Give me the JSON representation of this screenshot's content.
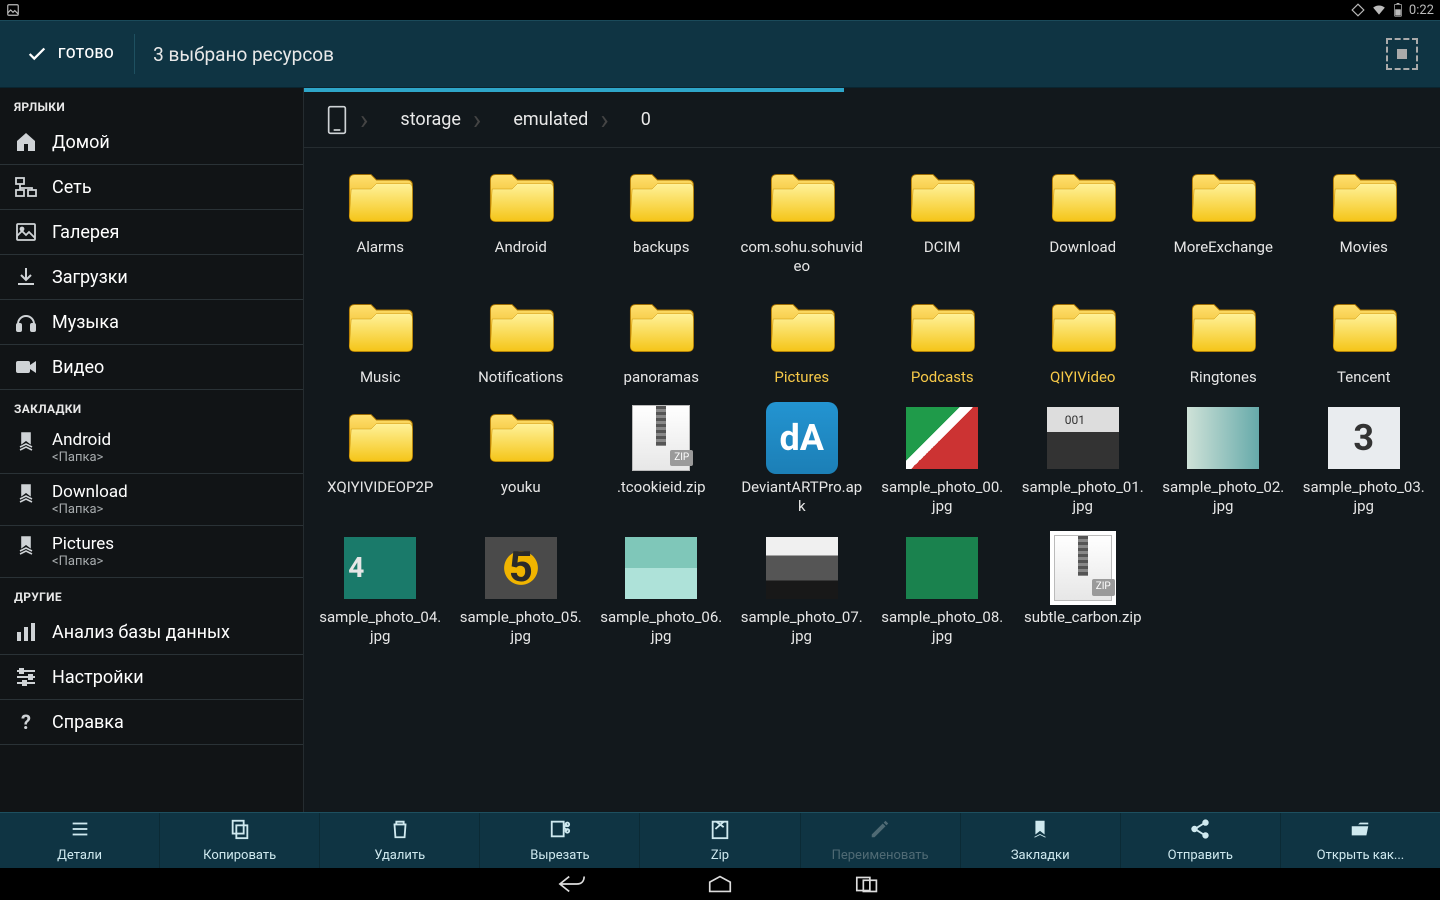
{
  "status_bar": {
    "time": "0:22"
  },
  "action_bar": {
    "done": "ГОТОВО",
    "title": "3 выбрано ресурсов"
  },
  "sidebar": {
    "sections": {
      "shortcuts": {
        "header": "ЯРЛЫКИ",
        "items": [
          {
            "label": "Домой",
            "icon": "home-icon"
          },
          {
            "label": "Сеть",
            "icon": "network-icon"
          },
          {
            "label": "Галерея",
            "icon": "gallery-icon"
          },
          {
            "label": "Загрузки",
            "icon": "download-icon"
          },
          {
            "label": "Музыка",
            "icon": "music-icon"
          },
          {
            "label": "Видео",
            "icon": "video-icon"
          }
        ]
      },
      "bookmarks": {
        "header": "ЗАКЛАДКИ",
        "items": [
          {
            "label": "Android",
            "sub": "<Папка>"
          },
          {
            "label": "Download",
            "sub": "<Папка>"
          },
          {
            "label": "Pictures",
            "sub": "<Папка>"
          }
        ]
      },
      "other": {
        "header": "ДРУГИЕ",
        "items": [
          {
            "label": "Анализ базы данных",
            "icon": "analytics-icon"
          },
          {
            "label": "Настройки",
            "icon": "settings-icon"
          },
          {
            "label": "Справка",
            "icon": "help-icon"
          }
        ]
      }
    }
  },
  "breadcrumb": [
    "storage",
    "emulated",
    "0"
  ],
  "grid": [
    {
      "type": "folder",
      "label": "Alarms",
      "selected": false
    },
    {
      "type": "folder",
      "label": "Android",
      "selected": false
    },
    {
      "type": "folder",
      "label": "backups",
      "selected": false
    },
    {
      "type": "folder",
      "label": "com.sohu.sohuvideo",
      "selected": false
    },
    {
      "type": "folder",
      "label": "DCIM",
      "selected": false
    },
    {
      "type": "folder",
      "label": "Download",
      "selected": false
    },
    {
      "type": "folder",
      "label": "MoreExchange",
      "selected": false
    },
    {
      "type": "folder",
      "label": "Movies",
      "selected": false
    },
    {
      "type": "folder",
      "label": "Music",
      "selected": false
    },
    {
      "type": "folder",
      "label": "Notifications",
      "selected": false
    },
    {
      "type": "folder",
      "label": "panoramas",
      "selected": false
    },
    {
      "type": "folder",
      "label": "Pictures",
      "selected": true
    },
    {
      "type": "folder",
      "label": "Podcasts",
      "selected": true
    },
    {
      "type": "folder",
      "label": "QIYIVideo",
      "selected": true
    },
    {
      "type": "folder",
      "label": "Ringtones",
      "selected": false
    },
    {
      "type": "folder",
      "label": "Tencent",
      "selected": false
    },
    {
      "type": "folder",
      "label": "XQIYIVIDEOP2P",
      "selected": false
    },
    {
      "type": "folder",
      "label": "youku",
      "selected": false
    },
    {
      "type": "zip",
      "label": ".tcookieid.zip",
      "selected": false
    },
    {
      "type": "app",
      "label": "DeviantARTPro.apk",
      "selected": false
    },
    {
      "type": "image",
      "label": "sample_photo_00.jpg",
      "variant": "p0",
      "selected": false
    },
    {
      "type": "image",
      "label": "sample_photo_01.jpg",
      "variant": "p1",
      "selected": false
    },
    {
      "type": "image",
      "label": "sample_photo_02.jpg",
      "variant": "p2",
      "selected": false
    },
    {
      "type": "image",
      "label": "sample_photo_03.jpg",
      "variant": "p3",
      "text": "3",
      "selected": false
    },
    {
      "type": "image",
      "label": "sample_photo_04.jpg",
      "variant": "p4",
      "text": "4",
      "selected": false
    },
    {
      "type": "image",
      "label": "sample_photo_05.jpg",
      "variant": "p5",
      "text": "5",
      "selected": false
    },
    {
      "type": "image",
      "label": "sample_photo_06.jpg",
      "variant": "p6",
      "selected": false
    },
    {
      "type": "image",
      "label": "sample_photo_07.jpg",
      "variant": "p7",
      "selected": false
    },
    {
      "type": "image",
      "label": "sample_photo_08.jpg",
      "variant": "p8",
      "selected": false
    },
    {
      "type": "zip",
      "label": "subtle_carbon.zip",
      "variant": "bordered",
      "selected": false
    }
  ],
  "bottom_bar": [
    {
      "label": "Детали",
      "icon": "details-icon",
      "enabled": true
    },
    {
      "label": "Копировать",
      "icon": "copy-icon",
      "enabled": true
    },
    {
      "label": "Удалить",
      "icon": "delete-icon",
      "enabled": true
    },
    {
      "label": "Вырезать",
      "icon": "cut-icon",
      "enabled": true
    },
    {
      "label": "Zip",
      "icon": "zip-icon",
      "enabled": true
    },
    {
      "label": "Переименовать",
      "icon": "rename-icon",
      "enabled": false
    },
    {
      "label": "Закладки",
      "icon": "bookmark-icon",
      "enabled": true
    },
    {
      "label": "Отправить",
      "icon": "share-icon",
      "enabled": true
    },
    {
      "label": "Открыть как...",
      "icon": "open-as-icon",
      "enabled": true
    }
  ]
}
